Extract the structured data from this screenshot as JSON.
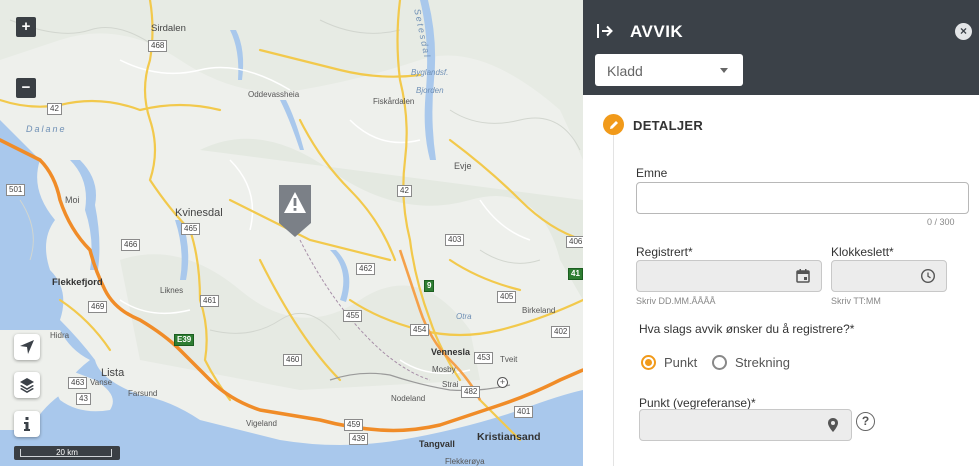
{
  "map": {
    "zoom_in": "+",
    "zoom_out": "−",
    "scale_text": "20 km",
    "places": {
      "sirdalen": "Sirdalen",
      "oddevassheia": "Oddevassheia",
      "fiskardalen": "Fiskårdalen",
      "byglandsfjorden": "Byglandsf.",
      "bjorden": "Bjorden",
      "dalane": "Dalane",
      "moi": "Moi",
      "kvinesdal": "Kvinesdal",
      "evje": "Evje",
      "flekkefjord": "Flekkefjord",
      "liknes": "Liknes",
      "hidra": "Hidra",
      "lista": "Lista",
      "vanse": "Vanse",
      "farsund": "Farsund",
      "otra": "Otra",
      "birkeland": "Birkeland",
      "vennesla": "Vennesla",
      "mosby": "Mosby",
      "tveit": "Tveit",
      "strai": "Strai",
      "nodeland": "Nodeland",
      "vigeland": "Vigeland",
      "tangvall": "Tangvall",
      "kristiansand": "Kristiansand",
      "flekkeroya": "Flekkerøya",
      "setesdal": "Setesdal"
    },
    "road_numbers": {
      "r468": "468",
      "r42a": "42",
      "r501": "501",
      "r465": "465",
      "r466": "466",
      "r469": "469",
      "r461": "461",
      "r42b": "42",
      "r403": "403",
      "r406": "406",
      "r462": "462",
      "r9": "9",
      "r455": "455",
      "r405": "405",
      "r454": "454",
      "r402": "402",
      "r460": "460",
      "r453": "453",
      "r463": "463",
      "r43": "43",
      "r482": "482",
      "r401": "401",
      "r459": "459",
      "r439": "439",
      "r41": "41",
      "e39": "E39"
    }
  },
  "panel": {
    "title": "AVVIK",
    "close": "×",
    "status": {
      "selected": "Kladd"
    },
    "section": {
      "title": "DETALJER"
    },
    "emne": {
      "label": "Emne",
      "value": "",
      "counter": "0 / 300"
    },
    "registrert": {
      "label": "Registrert*",
      "hint": "Skriv DD.MM.ÅÅÅÅ"
    },
    "klokkeslett": {
      "label": "Klokkeslett*",
      "hint": "Skriv TT:MM"
    },
    "question": "Hva slags avvik ønsker du å registrere?*",
    "options": {
      "punkt": "Punkt",
      "strekning": "Strekning",
      "selected": "Punkt"
    },
    "punkt": {
      "label": "Punkt (vegreferanse)*",
      "help": "?"
    }
  },
  "colors": {
    "header": "#3b4148",
    "accent": "#f19a1a",
    "road_major": "#f08c28",
    "road_secondary": "#f2c94c",
    "water": "#a9c8ec"
  }
}
